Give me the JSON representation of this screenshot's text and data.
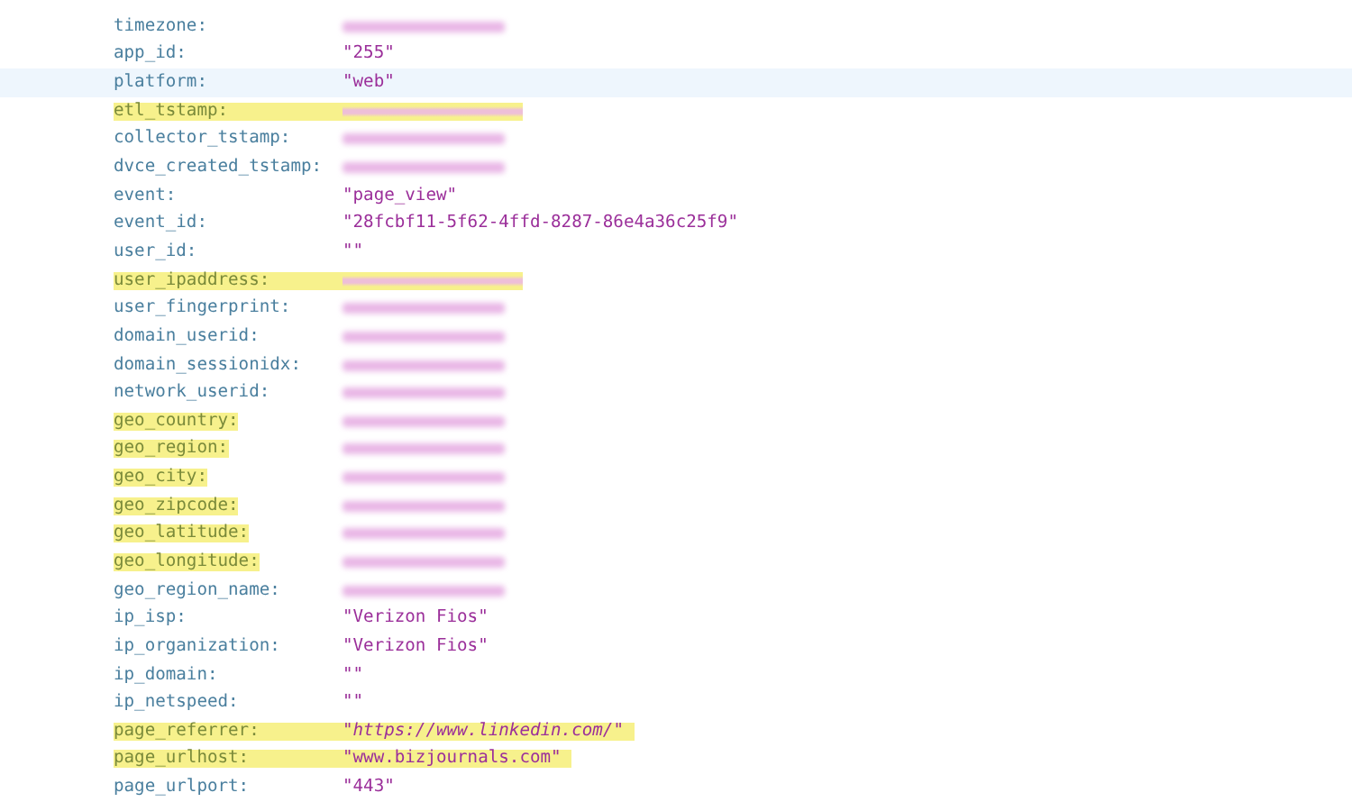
{
  "rows": [
    {
      "key": "timezone:",
      "kind": "redacted",
      "key_highlighted": false,
      "value_highlighted": false,
      "hovered": false
    },
    {
      "key": "app_id:",
      "kind": "text",
      "value": "\"255\"",
      "key_highlighted": false,
      "value_highlighted": false,
      "hovered": false
    },
    {
      "key": "platform:",
      "kind": "text",
      "value": "\"web\"",
      "key_highlighted": false,
      "value_highlighted": false,
      "hovered": true
    },
    {
      "key": "etl_tstamp:",
      "kind": "redacted",
      "key_highlighted": true,
      "value_highlighted": true,
      "hovered": false
    },
    {
      "key": "collector_tstamp:",
      "kind": "redacted",
      "key_highlighted": false,
      "value_highlighted": false,
      "hovered": false
    },
    {
      "key": "dvce_created_tstamp:",
      "kind": "redacted",
      "key_highlighted": false,
      "value_highlighted": false,
      "hovered": false
    },
    {
      "key": "event:",
      "kind": "text",
      "value": "\"page_view\"",
      "key_highlighted": false,
      "value_highlighted": false,
      "hovered": false
    },
    {
      "key": "event_id:",
      "kind": "text",
      "value": "\"28fcbf11-5f62-4ffd-8287-86e4a36c25f9\"",
      "key_highlighted": false,
      "value_highlighted": false,
      "hovered": false
    },
    {
      "key": "user_id:",
      "kind": "text",
      "value": "\"\"",
      "key_highlighted": false,
      "value_highlighted": false,
      "hovered": false
    },
    {
      "key": "user_ipaddress:",
      "kind": "redacted",
      "key_highlighted": true,
      "value_highlighted": true,
      "hovered": false
    },
    {
      "key": "user_fingerprint:",
      "kind": "redacted",
      "key_highlighted": false,
      "value_highlighted": false,
      "hovered": false
    },
    {
      "key": "domain_userid:",
      "kind": "redacted",
      "key_highlighted": false,
      "value_highlighted": false,
      "hovered": false
    },
    {
      "key": "domain_sessionidx:",
      "kind": "redacted",
      "key_highlighted": false,
      "value_highlighted": false,
      "hovered": false
    },
    {
      "key": "network_userid:",
      "kind": "redacted",
      "key_highlighted": false,
      "value_highlighted": false,
      "hovered": false
    },
    {
      "key": "geo_country:",
      "kind": "redacted",
      "key_highlighted": true,
      "value_highlighted": false,
      "hovered": false
    },
    {
      "key": "geo_region:",
      "kind": "redacted",
      "key_highlighted": true,
      "value_highlighted": false,
      "hovered": false
    },
    {
      "key": "geo_city:",
      "kind": "redacted",
      "key_highlighted": true,
      "value_highlighted": false,
      "hovered": false
    },
    {
      "key": "geo_zipcode:",
      "kind": "redacted",
      "key_highlighted": true,
      "value_highlighted": false,
      "hovered": false
    },
    {
      "key": "geo_latitude:",
      "kind": "redacted",
      "key_highlighted": true,
      "value_highlighted": false,
      "hovered": false
    },
    {
      "key": "geo_longitude:",
      "kind": "redacted",
      "key_highlighted": true,
      "value_highlighted": false,
      "hovered": false
    },
    {
      "key": "geo_region_name:",
      "kind": "redacted",
      "key_highlighted": false,
      "value_highlighted": false,
      "hovered": false
    },
    {
      "key": "ip_isp:",
      "kind": "text",
      "value": "\"Verizon Fios\"",
      "key_highlighted": false,
      "value_highlighted": false,
      "hovered": false
    },
    {
      "key": "ip_organization:",
      "kind": "text",
      "value": "\"Verizon Fios\"",
      "key_highlighted": false,
      "value_highlighted": false,
      "hovered": false
    },
    {
      "key": "ip_domain:",
      "kind": "text",
      "value": "\"\"",
      "key_highlighted": false,
      "value_highlighted": false,
      "hovered": false
    },
    {
      "key": "ip_netspeed:",
      "kind": "text",
      "value": "\"\"",
      "key_highlighted": false,
      "value_highlighted": false,
      "hovered": false
    },
    {
      "key": "page_referrer:",
      "kind": "text",
      "value": "*\"https://www.linkedin.com/*\"",
      "key_highlighted": true,
      "value_highlighted": true,
      "hovered": false
    },
    {
      "key": "page_urlhost:",
      "kind": "text",
      "value": "\"www.bizjournals.com\"",
      "key_highlighted": true,
      "value_highlighted": true,
      "hovered": false
    },
    {
      "key": "page_urlport:",
      "kind": "text",
      "value": "\"443\"",
      "key_highlighted": false,
      "value_highlighted": false,
      "hovered": false
    }
  ]
}
